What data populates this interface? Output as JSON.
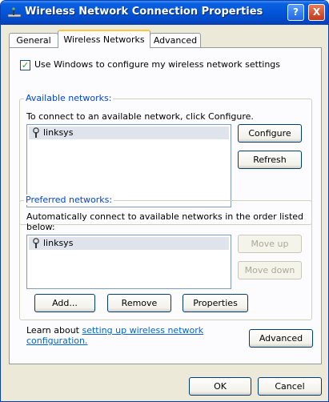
{
  "window": {
    "title": "Wireless Network Connection Properties",
    "help_label": "?",
    "close_label": "X"
  },
  "tabs": [
    {
      "label": "General"
    },
    {
      "label": "Wireless Networks"
    },
    {
      "label": "Advanced"
    }
  ],
  "use_windows_checkbox": {
    "checked": true,
    "label": "Use Windows to configure my wireless network settings"
  },
  "available": {
    "title": "Available networks:",
    "description": "To connect to an available network, click Configure.",
    "networks": [
      "linksys"
    ],
    "configure_label": "Configure",
    "refresh_label": "Refresh"
  },
  "preferred": {
    "title": "Preferred networks:",
    "description_line1": "Automatically connect to available networks in the order listed",
    "description_line2": "below:",
    "networks": [
      "linksys"
    ],
    "move_up_label": "Move up",
    "move_down_label": "Move down",
    "add_label": "Add...",
    "remove_label": "Remove",
    "properties_label": "Properties"
  },
  "learn": {
    "prefix": "Learn about",
    "link_line1": "setting up wireless network",
    "link_line2": "configuration."
  },
  "advanced_button_label": "Advanced",
  "ok_label": "OK",
  "cancel_label": "Cancel",
  "colors": {
    "title_bar": "#0255d8",
    "dialog_bg": "#ece9d8",
    "link": "#0066cc",
    "group_label": "#0046d5"
  }
}
